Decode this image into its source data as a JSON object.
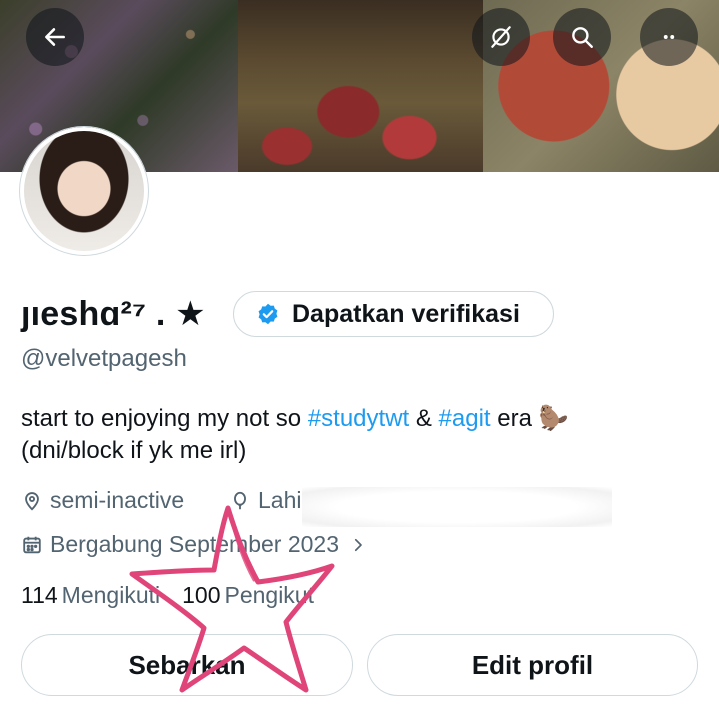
{
  "header": {
    "back_icon": "arrow-left-icon",
    "mute_icon": "mute-icon",
    "search_icon": "search-icon",
    "more_icon": "more-icon"
  },
  "profile": {
    "display_name": "ȷıeshɑ²⁷ . ★",
    "handle": "@velvetpagesh",
    "verify_label": "Dapatkan verifikasi",
    "bio": {
      "part1": "start to enjoying my not so ",
      "hashtag1": "#studytwt",
      "part2": " & ",
      "hashtag2": "#agit",
      "part3": " era 🦫",
      "line2": "(dni/block if yk me irl)"
    },
    "location": "semi-inactive",
    "birth_label": "Lahi",
    "joined": "Bergabung September 2023"
  },
  "stats": {
    "following_count": "114",
    "following_label": "Mengikuti",
    "followers_count": "100",
    "followers_label": "Pengikut"
  },
  "actions": {
    "share_label": "Sebarkan",
    "edit_label": "Edit profil"
  },
  "colors": {
    "accent": "#1d9bf0",
    "muted_text": "#536471",
    "border": "#cfd9de",
    "scribble": "#e0457a"
  }
}
